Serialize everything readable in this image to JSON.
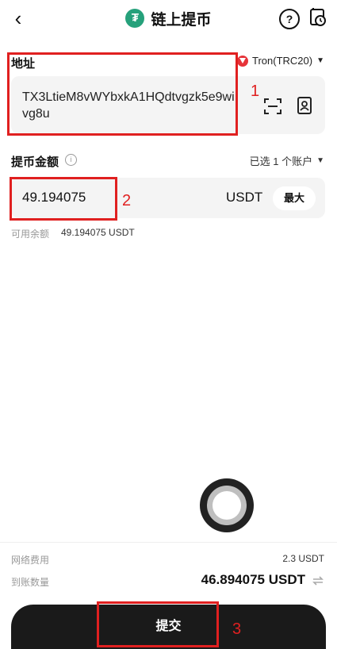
{
  "header": {
    "back_icon": "back-arrow-icon",
    "title": "链上提币",
    "coin_logo_glyph": "₮",
    "help_glyph": "?",
    "history_icon": "withdraw-history-icon"
  },
  "address": {
    "label": "地址",
    "network": "Tron(TRC20)",
    "value": "TX3LtieM8vWYbxkA1HQdtvgzk5e9wivg8u"
  },
  "amount": {
    "label": "提币金额",
    "account_selector": "已选 1 个账户",
    "value": "49.194075",
    "unit": "USDT",
    "max_label": "最大",
    "available_label": "可用余额",
    "available_value": "49.194075 USDT"
  },
  "summary": {
    "fee_label": "网络费用",
    "fee_value": "2.3 USDT",
    "receive_label": "到账数量",
    "receive_value": "46.894075 USDT"
  },
  "submit_label": "提交",
  "annotations": [
    "1",
    "2",
    "3"
  ],
  "colors": {
    "usdt_green": "#26a17b",
    "tron_red": "#e63339",
    "annotation_red": "#e02020",
    "button_dark": "#1a1a1a"
  }
}
